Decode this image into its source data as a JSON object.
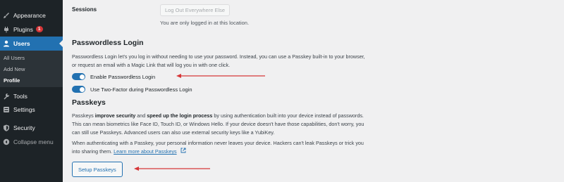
{
  "sidebar": {
    "items": [
      {
        "label": "Appearance",
        "icon": "paintbrush-icon"
      },
      {
        "label": "Plugins",
        "icon": "plugin-icon",
        "badge": "1"
      },
      {
        "label": "Users",
        "icon": "user-icon"
      },
      {
        "label": "Tools",
        "icon": "wrench-icon"
      },
      {
        "label": "Settings",
        "icon": "settings-icon"
      },
      {
        "label": "Security",
        "icon": "shield-icon"
      },
      {
        "label": "Collapse menu",
        "icon": "collapse-icon"
      }
    ],
    "submenu": [
      "All Users",
      "Add New",
      "Profile"
    ]
  },
  "sessions": {
    "label": "Sessions",
    "button": "Log Out Everywhere Else",
    "note": "You are only logged in at this location."
  },
  "passwordless": {
    "heading": "Passwordless Login",
    "description_line1": "Passwordless Login let's you log in without needing to use your password. Instead, you can use a Passkey built-in to your browser,",
    "description_line2": "or request an email with a Magic Link that will log you in with one click.",
    "toggle1": "Enable Passwordless Login",
    "toggle2": "Use Two-Factor during Passwordless Login"
  },
  "passkeys": {
    "heading": "Passkeys",
    "p1_a": "Passkeys ",
    "p1_b": "improve security",
    "p1_c": " and ",
    "p1_d": "speed up the login process",
    "p1_e": " by using authentication built into your device instead of passwords.",
    "p1_line2": "This can mean biometrics like Face ID, Touch ID, or Windows Hello. If your device doesn't have those capabilities, don't worry, you",
    "p1_line3": "can still use Passkeys. Advanced users can also use external security keys like a YubiKey.",
    "p2_line1": "When authenticating with a Passkey, your personal information never leaves your device. Hackers can't leak Passkeys or trick you",
    "p2_line2": "into sharing them.",
    "link": "Learn more about Passkeys",
    "button": "Setup Passkeys"
  },
  "colors": {
    "accent": "#2271b1",
    "sidebar_bg": "#1d2327",
    "arrow": "#d63638"
  }
}
